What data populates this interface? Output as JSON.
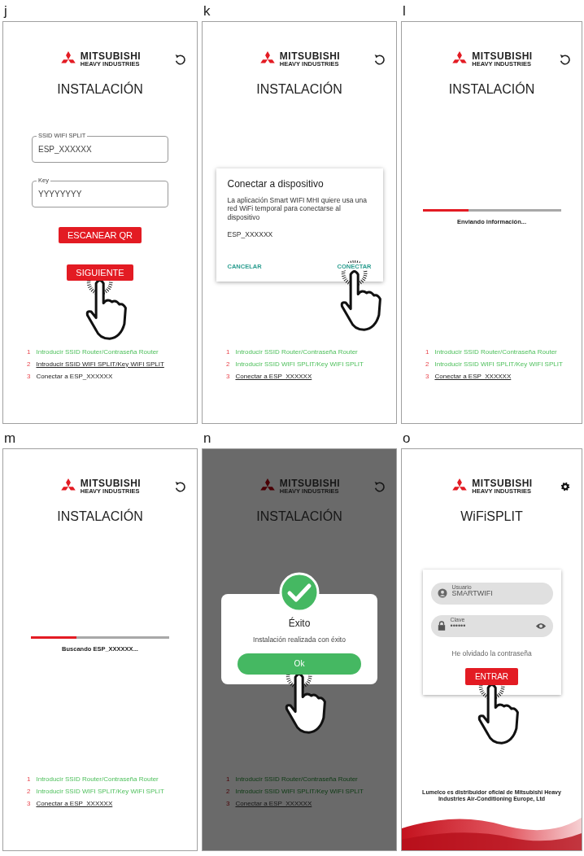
{
  "panels": [
    {
      "letter": "j",
      "kind": "form",
      "header_icon": {
        "kind": "refresh"
      },
      "logo": [
        "MITSUBISHI",
        "HEAVY INDUSTRIES"
      ],
      "title": "INSTALACIÓN",
      "dimmed": false,
      "fields": [
        {
          "label": "SSID WIFI SPLIT",
          "value": "ESP_XXXXXX"
        },
        {
          "label": "Key",
          "value": "YYYYYYYY"
        }
      ],
      "buttons": [
        {
          "label": "ESCANEAR QR",
          "tapped": false
        },
        {
          "label": "SIGUIENTE",
          "tapped": true
        }
      ],
      "steps": [
        {
          "number": "1",
          "text": "Introducir SSID Router/Contraseña Router",
          "done": true,
          "current": false
        },
        {
          "number": "2",
          "text": "Introducir SSID WIFI SPLIT/Key WIFI SPLIT",
          "done": false,
          "current": true
        },
        {
          "number": "3",
          "text": "Conectar a ESP_XXXXXX",
          "done": false,
          "current": false
        }
      ]
    },
    {
      "letter": "k",
      "kind": "dialog",
      "header_icon": {
        "kind": "refresh"
      },
      "logo": [
        "MITSUBISHI",
        "HEAVY INDUSTRIES"
      ],
      "title": "INSTALACIÓN",
      "dimmed": false,
      "dialog": {
        "title": "Conectar a dispositivo",
        "message": "La aplicación Smart WIFI MHI quiere usa una red WiFi temporal para conectarse al dispositivo",
        "value": "ESP_XXXXXX",
        "actions": [
          {
            "label": "CANCELAR",
            "tapped": false
          },
          {
            "label": "CONECTAR",
            "tapped": true
          }
        ]
      },
      "steps": [
        {
          "number": "1",
          "text": "Introducir SSID Router/Contraseña Router",
          "done": true,
          "current": false
        },
        {
          "number": "2",
          "text": "Introducir SSID WIFI SPLIT/Key WIFI SPLIT",
          "done": true,
          "current": false
        },
        {
          "number": "3",
          "text": "Conectar a ESP_XXXXXX",
          "done": false,
          "current": true
        }
      ]
    },
    {
      "letter": "l",
      "kind": "progress",
      "header_icon": {
        "kind": "refresh"
      },
      "logo": [
        "MITSUBISHI",
        "HEAVY INDUSTRIES"
      ],
      "title": "INSTALACIÓN",
      "dimmed": false,
      "progress": {
        "level": 0.33,
        "caption": "Enviando información..."
      },
      "steps": [
        {
          "number": "1",
          "text": "Introducir SSID Router/Contraseña Router",
          "done": true,
          "current": false
        },
        {
          "number": "2",
          "text": "Introducir SSID WIFI SPLIT/Key WIFI SPLIT",
          "done": true,
          "current": false
        },
        {
          "number": "3",
          "text": "Conectar a ESP_XXXXXX",
          "done": false,
          "current": true
        }
      ]
    },
    {
      "letter": "m",
      "kind": "progress",
      "header_icon": {
        "kind": "refresh"
      },
      "logo": [
        "MITSUBISHI",
        "HEAVY INDUSTRIES"
      ],
      "title": "INSTALACIÓN",
      "dimmed": false,
      "progress": {
        "level": 0.33,
        "caption": "Buscando ESP_XXXXXX..."
      },
      "steps": [
        {
          "number": "1",
          "text": "Introducir SSID Router/Contraseña Router",
          "done": true,
          "current": false
        },
        {
          "number": "2",
          "text": "Introducir SSID WIFI SPLIT/Key WIFI SPLIT",
          "done": true,
          "current": false
        },
        {
          "number": "3",
          "text": "Conectar a ESP_XXXXXX",
          "done": false,
          "current": true
        }
      ]
    },
    {
      "letter": "n",
      "kind": "success",
      "header_icon": {
        "kind": "refresh"
      },
      "logo": [
        "MITSUBISHI",
        "HEAVY INDUSTRIES"
      ],
      "title": "INSTALACIÓN",
      "dimmed": true,
      "success": {
        "title": "Éxito",
        "message": "Instalación realizada con éxito",
        "button": {
          "label": "Ok",
          "tapped": true
        }
      },
      "steps": [
        {
          "number": "1",
          "text": "Introducir SSID Router/Contraseña Router",
          "done": true,
          "current": false
        },
        {
          "number": "2",
          "text": "Introducir SSID WIFI SPLIT/Key WIFI SPLIT",
          "done": true,
          "current": false
        },
        {
          "number": "3",
          "text": "Conectar a ESP_XXXXXX",
          "done": false,
          "current": true
        }
      ]
    },
    {
      "letter": "o",
      "kind": "login",
      "header_icon": {
        "kind": "settings"
      },
      "logo": [
        "MITSUBISHI",
        "HEAVY INDUSTRIES"
      ],
      "title": "WiFiSPLIT",
      "dimmed": false,
      "login": {
        "fields": [
          {
            "kind": "user",
            "label": "Usuario",
            "value": "SMARTWIFI"
          },
          {
            "kind": "password",
            "label": "Clave",
            "value": "••••••"
          }
        ],
        "link": "He olvidado la contraseña",
        "button": {
          "label": "ENTRAR",
          "tapped": true
        }
      },
      "footer": "Lumelco es distribuidor oficial de Mitsubishi Heavy Industries Air-Conditioning Europe, Ltd"
    }
  ]
}
